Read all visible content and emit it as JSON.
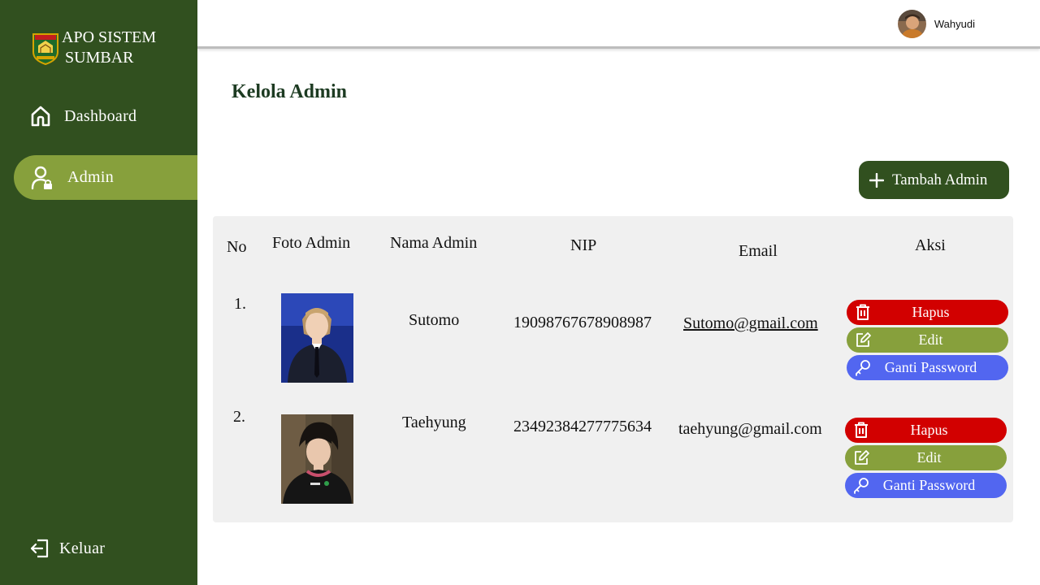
{
  "app": {
    "title_line1": "APO SISTEM",
    "title_line2": "SUMBAR"
  },
  "sidebar": {
    "items": [
      {
        "label": "Dashboard",
        "icon": "home-icon"
      },
      {
        "label": "Admin",
        "icon": "user-lock-icon",
        "active": true
      }
    ],
    "logout_label": "Keluar"
  },
  "header": {
    "user_name": "Wahyudi"
  },
  "main": {
    "title": "Kelola Admin",
    "add_button_label": "Tambah Admin"
  },
  "table": {
    "columns": [
      "No",
      "Foto Admin",
      "Nama Admin",
      "NIP",
      "Email",
      "Aksi"
    ],
    "rows": [
      {
        "no": "1.",
        "name": "Sutomo",
        "nip": "19098767678908987",
        "email": "Sutomo@gmail.com"
      },
      {
        "no": "2.",
        "name": "Taehyung",
        "nip": "23492384277775634",
        "email": "taehyung@gmail.com"
      }
    ],
    "actions": {
      "delete": "Hapus",
      "edit": "Edit",
      "password": "Ganti Password"
    }
  },
  "colors": {
    "sidebar": "#31501f",
    "active": "#87a03c",
    "delete": "#d20000",
    "edit": "#87a03c",
    "password": "#5266f0"
  }
}
